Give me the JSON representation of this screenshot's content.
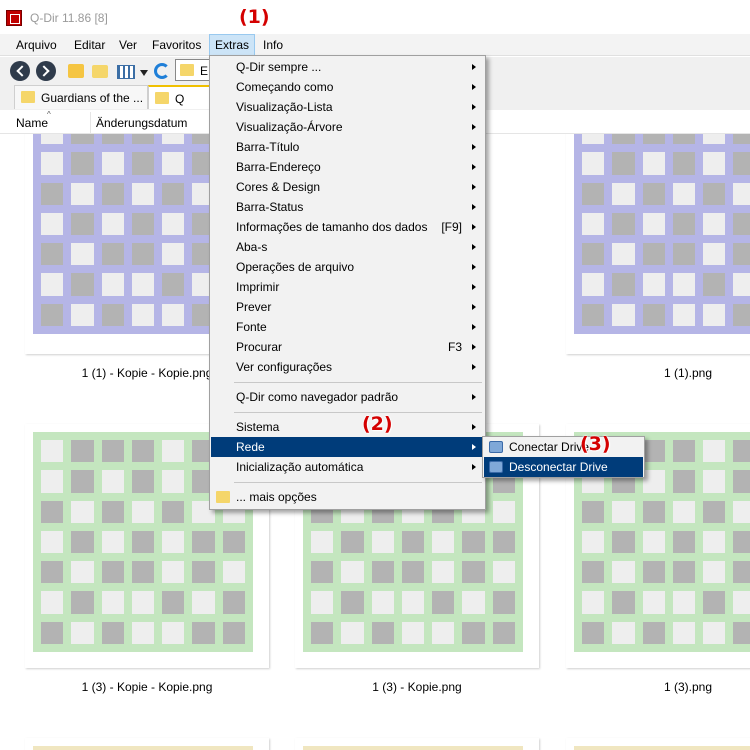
{
  "window": {
    "title": "Q-Dir 11.86 [8]"
  },
  "menubar": [
    "Arquivo",
    "Editar",
    "Ver",
    "Favoritos",
    "Extras",
    "Info"
  ],
  "address": {
    "value": "E:"
  },
  "tabs": [
    "Guardians of the ...",
    "Q"
  ],
  "columns": [
    "Name",
    "Änderungsdatum"
  ],
  "files": [
    "1 (1) - Kopie - Kopie.png",
    "1 (1).png",
    "1 (3) - Kopie - Kopie.png",
    "1 (3) - Kopie.png",
    "1 (3).png"
  ],
  "menu": {
    "items": [
      {
        "label": "Q-Dir sempre ...",
        "submenu": true
      },
      {
        "label": "Começando como",
        "submenu": true
      },
      {
        "label": "Visualização-Lista",
        "submenu": true
      },
      {
        "label": "Visualização-Árvore",
        "submenu": true
      },
      {
        "label": "Barra-Título",
        "submenu": true
      },
      {
        "label": "Barra-Endereço",
        "submenu": true
      },
      {
        "label": "Cores & Design",
        "submenu": true
      },
      {
        "label": "Barra-Status",
        "submenu": true
      },
      {
        "label": "Informações de tamanho dos dados",
        "shortcut": "[F9]",
        "submenu": true
      },
      {
        "label": "Aba-s",
        "submenu": true
      },
      {
        "label": "Operações de arquivo",
        "submenu": true
      },
      {
        "label": "Imprimir",
        "submenu": true
      },
      {
        "label": "Prever",
        "submenu": true
      },
      {
        "label": "Fonte",
        "submenu": true
      },
      {
        "label": "Procurar",
        "shortcut": "F3",
        "submenu": true
      },
      {
        "label": "Ver configurações",
        "submenu": true
      },
      {
        "label": "Q-Dir como navegador padrão",
        "submenu": true
      },
      {
        "label": "Sistema",
        "submenu": true
      },
      {
        "label": "Rede",
        "submenu": true,
        "highlighted": true
      },
      {
        "label": "Inicialização automática",
        "submenu": true
      },
      {
        "label": "... mais opções"
      }
    ]
  },
  "submenu": {
    "items": [
      {
        "label": "Conectar Drive"
      },
      {
        "label": "Desconectar Drive",
        "highlighted": true
      }
    ]
  },
  "callouts": [
    "(1)",
    "(2)",
    "(3)"
  ],
  "colors": {
    "thumb_purple": "#b5b5e6",
    "thumb_green": "#c4e6bf",
    "thumb_yellow": "#f0e6c0",
    "menu_highlight": "#003c7a",
    "callout_red": "#d40000"
  }
}
